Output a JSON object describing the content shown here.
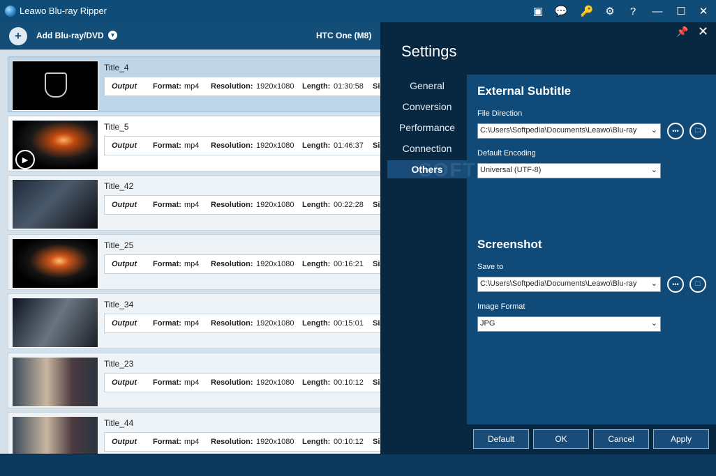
{
  "app": {
    "title": "Leawo Blu-ray Ripper"
  },
  "toolbar": {
    "add_label": "Add Blu-ray/DVD",
    "device_label": "HTC One (M8)"
  },
  "titles": [
    {
      "name": "Title_4",
      "output": "Output",
      "format_label": "Format:",
      "format": "mp4",
      "resolution_label": "Resolution:",
      "resolution": "1920x1080",
      "length_label": "Length:",
      "length": "01:30:58",
      "size_label": "Siz"
    },
    {
      "name": "Title_5",
      "output": "Output",
      "format_label": "Format:",
      "format": "mp4",
      "resolution_label": "Resolution:",
      "resolution": "1920x1080",
      "length_label": "Length:",
      "length": "01:46:37",
      "size_label": "Siz"
    },
    {
      "name": "Title_42",
      "output": "Output",
      "format_label": "Format:",
      "format": "mp4",
      "resolution_label": "Resolution:",
      "resolution": "1920x1080",
      "length_label": "Length:",
      "length": "00:22:28",
      "size_label": "Siz"
    },
    {
      "name": "Title_25",
      "output": "Output",
      "format_label": "Format:",
      "format": "mp4",
      "resolution_label": "Resolution:",
      "resolution": "1920x1080",
      "length_label": "Length:",
      "length": "00:16:21",
      "size_label": "Siz"
    },
    {
      "name": "Title_34",
      "output": "Output",
      "format_label": "Format:",
      "format": "mp4",
      "resolution_label": "Resolution:",
      "resolution": "1920x1080",
      "length_label": "Length:",
      "length": "00:15:01",
      "size_label": "Siz"
    },
    {
      "name": "Title_23",
      "output": "Output",
      "format_label": "Format:",
      "format": "mp4",
      "resolution_label": "Resolution:",
      "resolution": "1920x1080",
      "length_label": "Length:",
      "length": "00:10:12",
      "size_label": "Siz"
    },
    {
      "name": "Title_44",
      "output": "Output",
      "format_label": "Format:",
      "format": "mp4",
      "resolution_label": "Resolution:",
      "resolution": "1920x1080",
      "length_label": "Length:",
      "length": "00:10:12",
      "size_label": "Siz"
    }
  ],
  "settings": {
    "heading": "Settings",
    "nav": [
      "General",
      "Conversion",
      "Performance",
      "Connection",
      "Others"
    ],
    "active_nav": "Others",
    "external_subtitle": {
      "title": "External Subtitle",
      "file_direction_label": "File Direction",
      "file_direction_value": "C:\\Users\\Softpedia\\Documents\\Leawo\\Blu-ray",
      "default_encoding_label": "Default Encoding",
      "default_encoding_value": "Universal (UTF-8)"
    },
    "screenshot": {
      "title": "Screenshot",
      "save_to_label": "Save to",
      "save_to_value": "C:\\Users\\Softpedia\\Documents\\Leawo\\Blu-ray",
      "image_format_label": "Image Format",
      "image_format_value": "JPG"
    },
    "buttons": {
      "default": "Default",
      "ok": "OK",
      "cancel": "Cancel",
      "apply": "Apply"
    }
  },
  "watermark": "SOFTPEDIA",
  "colors": {
    "titlebar": "#0f4c78",
    "panel": "#082842",
    "content": "#0f4a78",
    "accent": "#194c78"
  }
}
